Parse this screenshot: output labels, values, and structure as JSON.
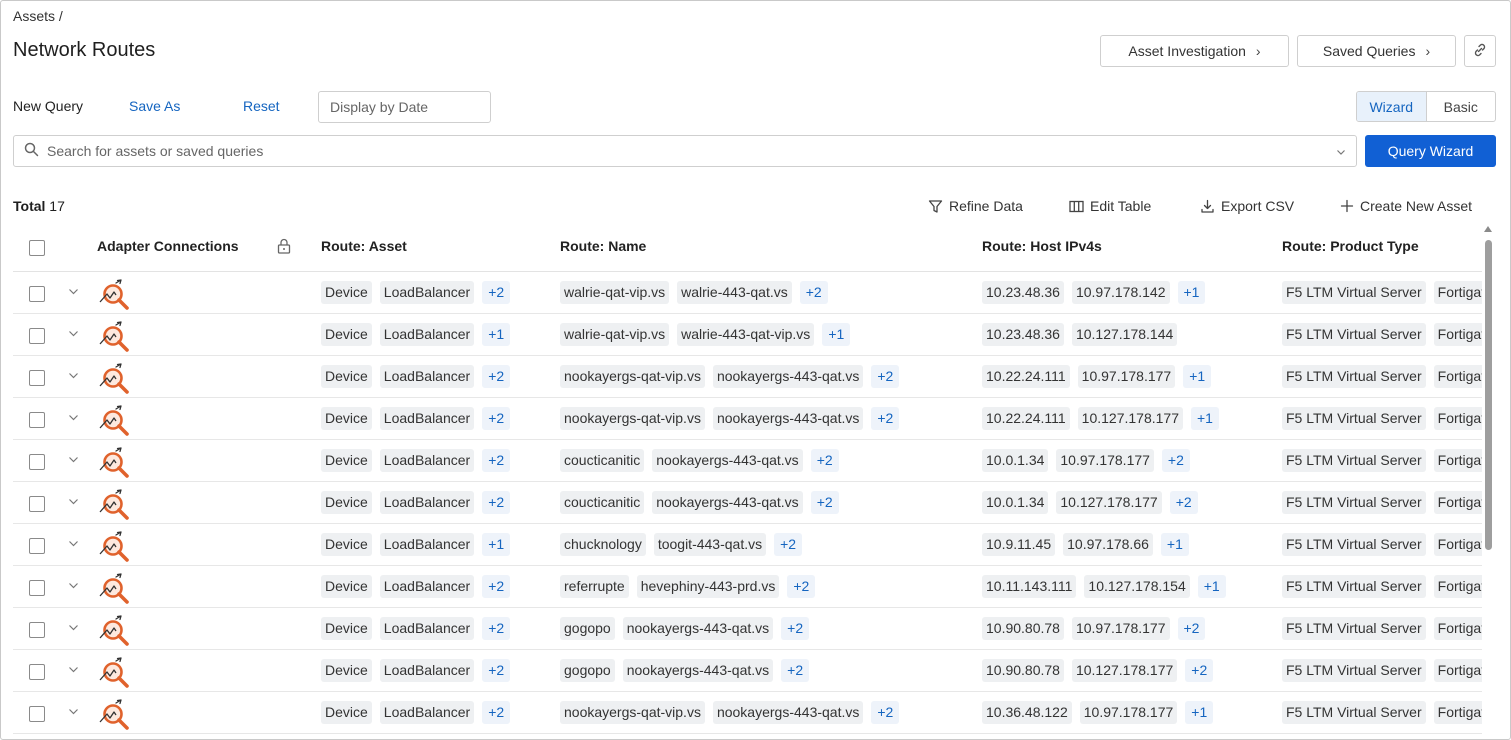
{
  "breadcrumb": "Assets /",
  "page_title": "Network Routes",
  "header_buttons": {
    "asset_investigation": "Asset Investigation",
    "saved_queries": "Saved Queries",
    "chevron": "›"
  },
  "query_bar": {
    "new_query": "New Query",
    "save_as": "Save As",
    "reset": "Reset",
    "display_by_date": "Display by Date",
    "mode_wizard": "Wizard",
    "mode_basic": "Basic",
    "active_mode": "Wizard"
  },
  "search": {
    "placeholder": "Search for assets or saved queries",
    "button": "Query Wizard"
  },
  "toolbar": {
    "total_label": "Total",
    "total_count": "17",
    "refine_data": "Refine Data",
    "edit_table": "Edit Table",
    "export_csv": "Export CSV",
    "create_new_asset": "Create New Asset"
  },
  "table": {
    "columns": [
      "Adapter Connections",
      "Route: Asset",
      "Route: Name",
      "Route: Host IPv4s",
      "Route: Product Type"
    ],
    "rows": [
      {
        "asset": [
          "Device",
          "LoadBalancer",
          "+2"
        ],
        "name": [
          "walrie-qat-vip.vs",
          "walrie-443-qat.vs",
          "+2"
        ],
        "ipv4": [
          "10.23.48.36",
          "10.97.178.142",
          "+1"
        ],
        "product": [
          "F5 LTM Virtual Server",
          "Fortigat"
        ]
      },
      {
        "asset": [
          "Device",
          "LoadBalancer",
          "+1"
        ],
        "name": [
          "walrie-qat-vip.vs",
          "walrie-443-qat-vip.vs",
          "+1"
        ],
        "ipv4": [
          "10.23.48.36",
          "10.127.178.144"
        ],
        "product": [
          "F5 LTM Virtual Server",
          "Fortigat"
        ]
      },
      {
        "asset": [
          "Device",
          "LoadBalancer",
          "+2"
        ],
        "name": [
          "nookayergs-qat-vip.vs",
          "nookayergs-443-qat.vs",
          "+2"
        ],
        "ipv4": [
          "10.22.24.111",
          "10.97.178.177",
          "+1"
        ],
        "product": [
          "F5 LTM Virtual Server",
          "Fortigat"
        ]
      },
      {
        "asset": [
          "Device",
          "LoadBalancer",
          "+2"
        ],
        "name": [
          "nookayergs-qat-vip.vs",
          "nookayergs-443-qat.vs",
          "+2"
        ],
        "ipv4": [
          "10.22.24.111",
          "10.127.178.177",
          "+1"
        ],
        "product": [
          "F5 LTM Virtual Server",
          "Fortigat"
        ]
      },
      {
        "asset": [
          "Device",
          "LoadBalancer",
          "+2"
        ],
        "name": [
          "coucticanitic",
          "nookayergs-443-qat.vs",
          "+2"
        ],
        "ipv4": [
          "10.0.1.34",
          "10.97.178.177",
          "+2"
        ],
        "product": [
          "F5 LTM Virtual Server",
          "Fortigat"
        ]
      },
      {
        "asset": [
          "Device",
          "LoadBalancer",
          "+2"
        ],
        "name": [
          "coucticanitic",
          "nookayergs-443-qat.vs",
          "+2"
        ],
        "ipv4": [
          "10.0.1.34",
          "10.127.178.177",
          "+2"
        ],
        "product": [
          "F5 LTM Virtual Server",
          "Fortigat"
        ]
      },
      {
        "asset": [
          "Device",
          "LoadBalancer",
          "+1"
        ],
        "name": [
          "chucknology",
          "toogit-443-qat.vs",
          "+2"
        ],
        "ipv4": [
          "10.9.11.45",
          "10.97.178.66",
          "+1"
        ],
        "product": [
          "F5 LTM Virtual Server",
          "Fortigat"
        ]
      },
      {
        "asset": [
          "Device",
          "LoadBalancer",
          "+2"
        ],
        "name": [
          "referrupte",
          "hevephiny-443-prd.vs",
          "+2"
        ],
        "ipv4": [
          "10.11.143.111",
          "10.127.178.154",
          "+1"
        ],
        "product": [
          "F5 LTM Virtual Server",
          "Fortigat"
        ]
      },
      {
        "asset": [
          "Device",
          "LoadBalancer",
          "+2"
        ],
        "name": [
          "gogopo",
          "nookayergs-443-qat.vs",
          "+2"
        ],
        "ipv4": [
          "10.90.80.78",
          "10.97.178.177",
          "+2"
        ],
        "product": [
          "F5 LTM Virtual Server",
          "Fortigat"
        ]
      },
      {
        "asset": [
          "Device",
          "LoadBalancer",
          "+2"
        ],
        "name": [
          "gogopo",
          "nookayergs-443-qat.vs",
          "+2"
        ],
        "ipv4": [
          "10.90.80.78",
          "10.127.178.177",
          "+2"
        ],
        "product": [
          "F5 LTM Virtual Server",
          "Fortigat"
        ]
      },
      {
        "asset": [
          "Device",
          "LoadBalancer",
          "+2"
        ],
        "name": [
          "nookayergs-qat-vip.vs",
          "nookayergs-443-qat.vs",
          "+2"
        ],
        "ipv4": [
          "10.36.48.122",
          "10.97.178.177",
          "+1"
        ],
        "product": [
          "F5 LTM Virtual Server",
          "Fortigat"
        ]
      }
    ]
  },
  "icons": {
    "search": "search-icon",
    "link": "link-icon",
    "filter": "filter-icon",
    "columns": "columns-icon",
    "download": "download-icon",
    "plus": "plus-icon",
    "lock": "lock-icon",
    "adapter": "network-scan-adapter-icon"
  },
  "colors": {
    "accent": "#1160d4",
    "link": "#1565c0",
    "chip_bg": "#eef0f2",
    "adapter_orange": "#e0622c"
  }
}
